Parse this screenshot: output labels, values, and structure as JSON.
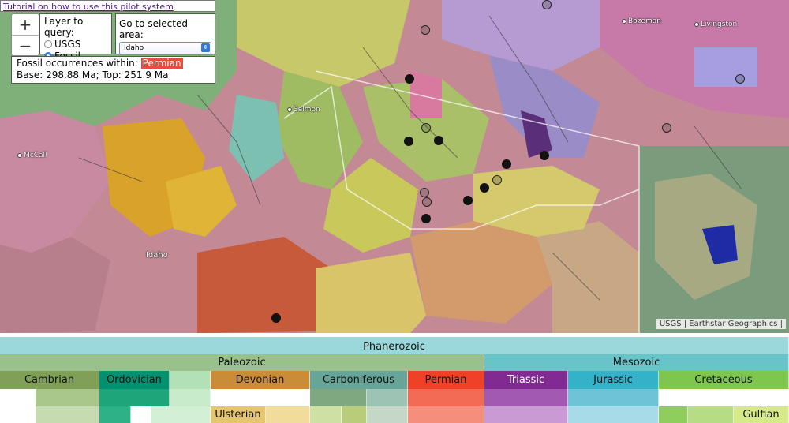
{
  "tutorial_link": "Tutorial on how to use this pilot system",
  "zoom": {
    "plus": "+",
    "minus": "−"
  },
  "layer_query": {
    "title": "Layer to query:",
    "options": [
      "USGS",
      "Fossil"
    ],
    "selected": "Fossil"
  },
  "goto_area": {
    "title": "Go to selected area:",
    "selected": "Idaho"
  },
  "info": {
    "prefix": "Fossil occurrences within:",
    "period": "Permian",
    "range": "Base: 298.88 Ma; Top: 251.9 Ma"
  },
  "places": [
    "Bozeman",
    "Livingston",
    "Salmon",
    "McCall",
    "Idaho"
  ],
  "attribution": "USGS | Earthstar Geographics |",
  "timescale": {
    "eon": "Phanerozoic",
    "eras": [
      "Paleozoic",
      "Mesozoic"
    ],
    "periods": [
      "Cambrian",
      "Ordovician",
      "Devonian",
      "Carboniferous",
      "Permian",
      "Triassic",
      "Jurassic",
      "Cretaceous"
    ],
    "epochs": [
      "Ulsterian",
      "Gulfian"
    ]
  },
  "colors": {
    "eon": "#9ad9db",
    "paleozoic": "#99c08d",
    "mesozoic": "#67c5ca",
    "cambrian": "#7fa056",
    "ordovician": "#009270",
    "silurian": "#b3e1b6",
    "devonian": "#cb8c37",
    "carboniferous": "#67a599",
    "permian": "#f04028",
    "triassic": "#812b92",
    "jurassic": "#34b2c9",
    "cretaceous": "#7fc64e",
    "fossil_dot": "#111111"
  }
}
